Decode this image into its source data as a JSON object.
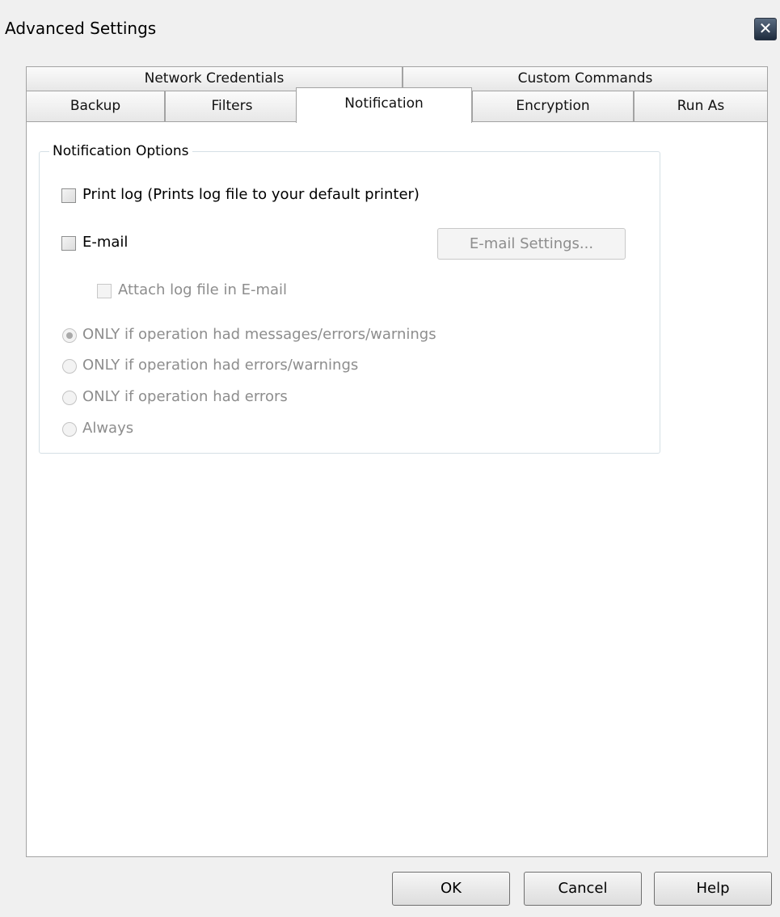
{
  "window": {
    "title": "Advanced Settings",
    "close_label": "✕"
  },
  "tabs": {
    "row1": [
      "Network Credentials",
      "Custom Commands"
    ],
    "row2": [
      "Backup",
      "Filters",
      "Notification",
      "Encryption",
      "Run As"
    ],
    "active": "Notification"
  },
  "notification_options": {
    "legend": "Notification Options",
    "print_log": {
      "label": "Print log (Prints log file to your default printer)",
      "checked": false
    },
    "email": {
      "label": "E-mail",
      "checked": false
    },
    "email_settings_button": "E-mail Settings...",
    "attach_log": {
      "label": "Attach log file in E-mail",
      "checked": false,
      "enabled": false
    },
    "conditions": [
      {
        "label": "ONLY if operation had messages/errors/warnings",
        "selected": true
      },
      {
        "label": "ONLY if operation had errors/warnings",
        "selected": false
      },
      {
        "label": "ONLY if operation had errors",
        "selected": false
      },
      {
        "label": "Always",
        "selected": false
      }
    ]
  },
  "footer": {
    "ok": "OK",
    "cancel": "Cancel",
    "help": "Help"
  }
}
